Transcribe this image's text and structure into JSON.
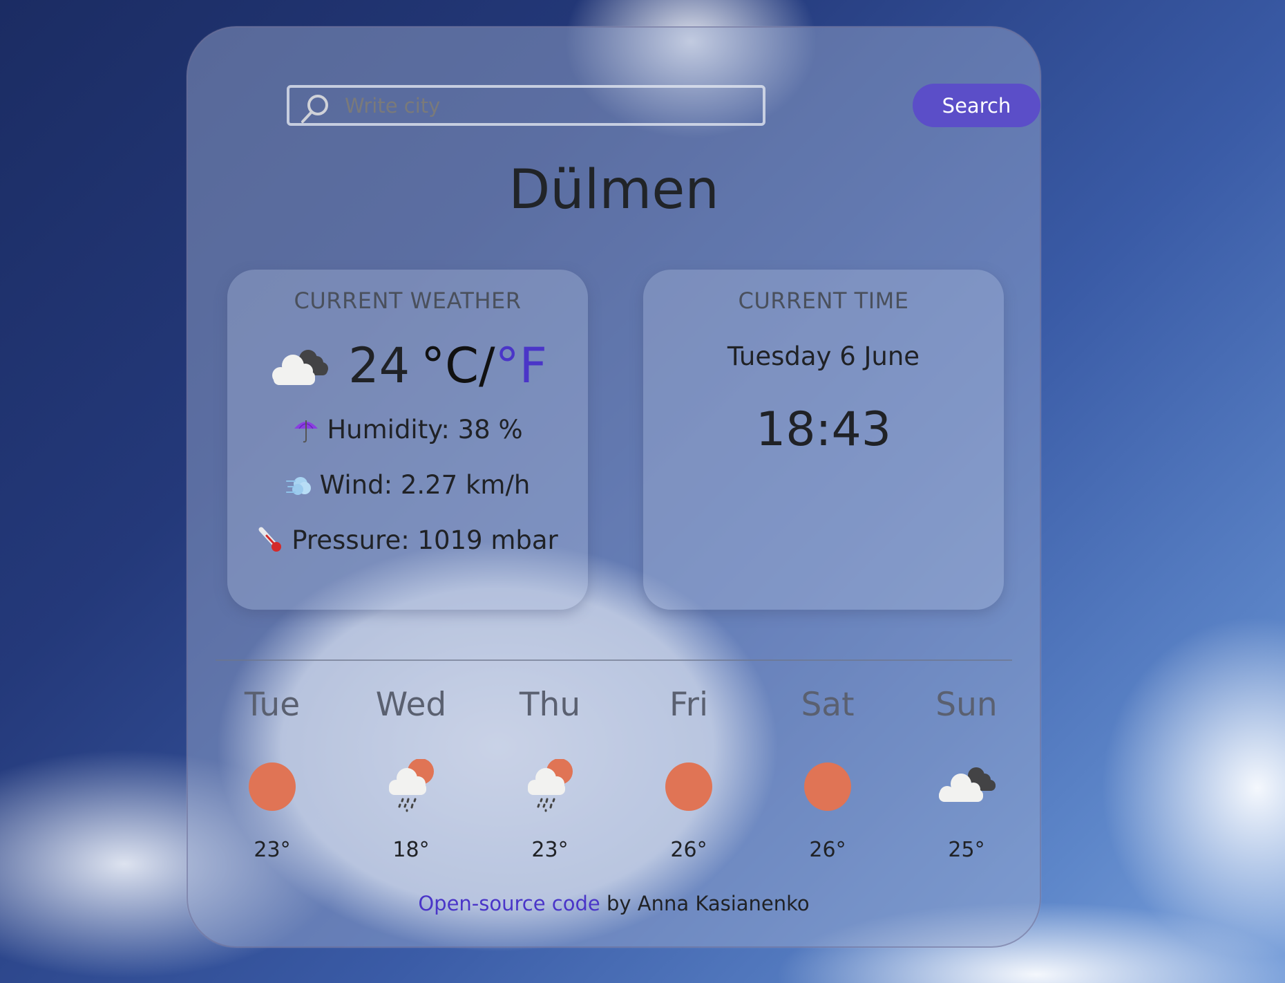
{
  "search": {
    "placeholder": "Write city",
    "value": "",
    "button_label": "Search",
    "icon": "search-icon"
  },
  "city": "Dülmen",
  "current_weather": {
    "title": "CURRENT WEATHER",
    "icon": "cloudy-icon",
    "temperature": "24",
    "unit_celsius": "°C/",
    "unit_fahrenheit": "°F",
    "humidity": {
      "icon": "umbrella-icon",
      "label": "Humidity: 38 %"
    },
    "wind": {
      "icon": "wind-icon",
      "label": "Wind: 2.27 km/h"
    },
    "pressure": {
      "icon": "thermometer-icon",
      "label": "Pressure: 1019 mbar"
    }
  },
  "current_time": {
    "title": "CURRENT TIME",
    "date": "Tuesday 6 June",
    "time": "18:43"
  },
  "forecast": [
    {
      "day": "Tue",
      "icon": "sun-icon",
      "temp": "23°"
    },
    {
      "day": "Wed",
      "icon": "rain-sun-icon",
      "temp": "18°"
    },
    {
      "day": "Thu",
      "icon": "rain-sun-icon",
      "temp": "23°"
    },
    {
      "day": "Fri",
      "icon": "sun-icon",
      "temp": "26°"
    },
    {
      "day": "Sat",
      "icon": "sun-icon",
      "temp": "26°"
    },
    {
      "day": "Sun",
      "icon": "cloudy-icon",
      "temp": "25°"
    }
  ],
  "footer": {
    "link_text": "Open-source code",
    "text": " by Anna Kasianenko"
  },
  "colors": {
    "accent": "#5b4ec8",
    "link": "#4a35c8",
    "sun": "#e07455"
  }
}
